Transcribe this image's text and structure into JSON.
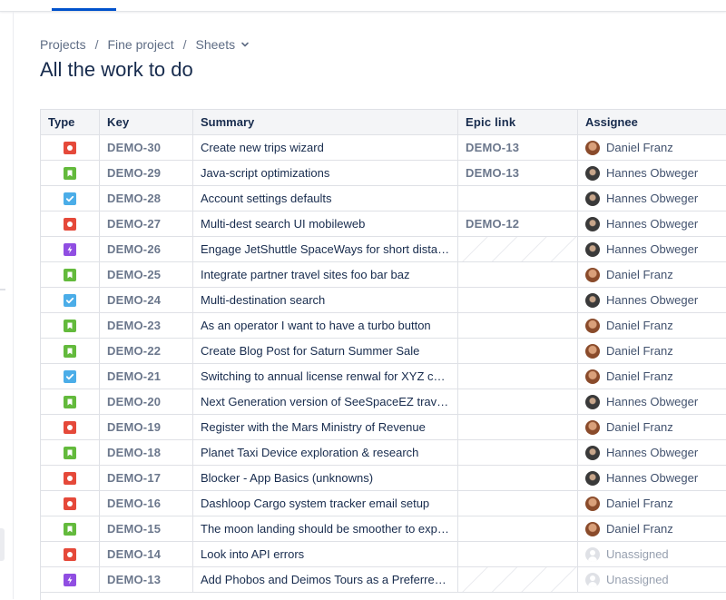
{
  "breadcrumb": {
    "items": [
      "Projects",
      "Fine project",
      "Sheets"
    ],
    "separator": "/"
  },
  "page": {
    "title": "All the work to do"
  },
  "colors": {
    "bug": "#e5493a",
    "story": "#63ba3c",
    "task": "#4bade8",
    "subtask": "#904ee2",
    "accent": "#0052cc"
  },
  "table": {
    "columns": [
      "Type",
      "Key",
      "Summary",
      "Epic link",
      "Assignee"
    ],
    "rows": [
      {
        "type": "bug",
        "key": "DEMO-30",
        "summary": "Create new trips wizard",
        "epic": "DEMO-13",
        "epic_hatched": false,
        "assignee": "Daniel Franz",
        "avatar": "daniel"
      },
      {
        "type": "story",
        "key": "DEMO-29",
        "summary": "Java-script optimizations",
        "epic": "DEMO-13",
        "epic_hatched": false,
        "assignee": "Hannes Obweger",
        "avatar": "hannes"
      },
      {
        "type": "task",
        "key": "DEMO-28",
        "summary": "Account settings defaults",
        "epic": "",
        "epic_hatched": false,
        "assignee": "Hannes Obweger",
        "avatar": "hannes"
      },
      {
        "type": "bug",
        "key": "DEMO-27",
        "summary": "Multi-dest search UI mobileweb",
        "epic": "DEMO-12",
        "epic_hatched": false,
        "assignee": "Hannes Obweger",
        "avatar": "hannes"
      },
      {
        "type": "subtask",
        "key": "DEMO-26",
        "summary": "Engage JetShuttle SpaceWays for short distance space travel",
        "epic": "",
        "epic_hatched": true,
        "assignee": "Hannes Obweger",
        "avatar": "hannes"
      },
      {
        "type": "story",
        "key": "DEMO-25",
        "summary": "Integrate partner travel sites foo bar baz",
        "epic": "",
        "epic_hatched": false,
        "assignee": "Daniel Franz",
        "avatar": "daniel"
      },
      {
        "type": "task",
        "key": "DEMO-24",
        "summary": "Multi-destination search",
        "epic": "",
        "epic_hatched": false,
        "assignee": "Hannes Obweger",
        "avatar": "hannes"
      },
      {
        "type": "story",
        "key": "DEMO-23",
        "summary": "As an operator I want to have a turbo button",
        "epic": "",
        "epic_hatched": false,
        "assignee": "Daniel Franz",
        "avatar": "daniel"
      },
      {
        "type": "story",
        "key": "DEMO-22",
        "summary": "Create Blog Post for Saturn Summer Sale",
        "epic": "",
        "epic_hatched": false,
        "assignee": "Daniel Franz",
        "avatar": "daniel"
      },
      {
        "type": "task",
        "key": "DEMO-21",
        "summary": "Switching to annual license renwal for XYZ customers",
        "epic": "",
        "epic_hatched": false,
        "assignee": "Daniel Franz",
        "avatar": "daniel"
      },
      {
        "type": "story",
        "key": "DEMO-20",
        "summary": "Next Generation version of SeeSpaceEZ travel app",
        "epic": "",
        "epic_hatched": false,
        "assignee": "Hannes Obweger",
        "avatar": "hannes"
      },
      {
        "type": "bug",
        "key": "DEMO-19",
        "summary": "Register with the Mars Ministry of Revenue",
        "epic": "",
        "epic_hatched": false,
        "assignee": "Daniel Franz",
        "avatar": "daniel"
      },
      {
        "type": "story",
        "key": "DEMO-18",
        "summary": "Planet Taxi Device exploration & research",
        "epic": "",
        "epic_hatched": false,
        "assignee": "Hannes Obweger",
        "avatar": "hannes"
      },
      {
        "type": "bug",
        "key": "DEMO-17",
        "summary": "Blocker - App Basics (unknowns)",
        "epic": "",
        "epic_hatched": false,
        "assignee": "Hannes Obweger",
        "avatar": "hannes"
      },
      {
        "type": "bug",
        "key": "DEMO-16",
        "summary": "Dashloop Cargo system tracker email setup",
        "epic": "",
        "epic_hatched": false,
        "assignee": "Daniel Franz",
        "avatar": "daniel"
      },
      {
        "type": "story",
        "key": "DEMO-15",
        "summary": "The moon landing should be smoother to experience",
        "epic": "",
        "epic_hatched": false,
        "assignee": "Daniel Franz",
        "avatar": "daniel"
      },
      {
        "type": "bug",
        "key": "DEMO-14",
        "summary": "Look into API errors",
        "epic": "",
        "epic_hatched": false,
        "assignee": "Unassigned",
        "avatar": "unassigned"
      },
      {
        "type": "subtask",
        "key": "DEMO-13",
        "summary": "Add Phobos and Deimos Tours as a Preferred Partner",
        "epic": "",
        "epic_hatched": true,
        "assignee": "Unassigned",
        "avatar": "unassigned"
      }
    ]
  }
}
